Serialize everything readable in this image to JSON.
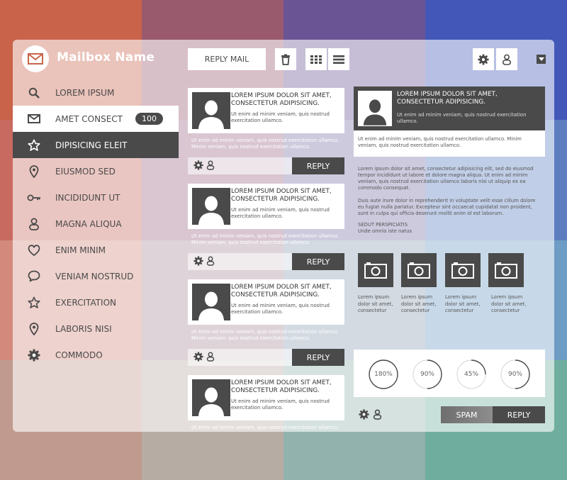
{
  "header": {
    "title": "Mailbox Name"
  },
  "sidebar": {
    "items": [
      {
        "label": "LOREM IPSUM",
        "icon": "search-icon"
      },
      {
        "label": "AMET CONSECT",
        "icon": "mail-icon",
        "badge": "100"
      },
      {
        "label": "DIPISICING ELEIT",
        "icon": "star-icon"
      },
      {
        "label": "EIUSMOD SED",
        "icon": "location-pin-icon"
      },
      {
        "label": "INCIDIDUNT UT",
        "icon": "key-icon"
      },
      {
        "label": "MAGNA ALIQUA",
        "icon": "user-icon"
      },
      {
        "label": "ENIM MINIM",
        "icon": "heart-icon"
      },
      {
        "label": "VENIAM NOSTRUD",
        "icon": "chat-bubble-icon"
      },
      {
        "label": "EXERCITATION",
        "icon": "star-icon"
      },
      {
        "label": "LABORIS NISI",
        "icon": "location-pin-icon"
      },
      {
        "label": "COMMODO",
        "icon": "gear-icon"
      }
    ]
  },
  "toolbar": {
    "reply_mail_label": "REPLY MAIL"
  },
  "messages": [
    {
      "title": "LOREM IPSUM DOLOR SIT AMET, CONSECTETUR ADIPISICING.",
      "snippet": "Ut enim ad minim veniam, quis nostrud exercitation ullamco.",
      "sub": "Ut enim ad minim veniam, quis nostrud exercitation ullamco. Minim veniam, quis nostrud exercitation ullamco.",
      "reply_label": "REPLY"
    },
    {
      "title": "LOREM IPSUM DOLOR SIT AMET, CONSECTETUR ADIPISICING.",
      "snippet": "Ut enim ad minim veniam, quis nostrud exercitation ullamco.",
      "sub": "Ut enim ad minim veniam, quis nostrud exercitation ullamco. Minim veniam, quis nostrud exercitation ullamco.",
      "reply_label": "REPLY"
    },
    {
      "title": "LOREM IPSUM DOLOR SIT AMET, CONSECTETUR ADIPISICING.",
      "snippet": "Ut enim ad minim veniam, quis nostrud exercitation ullamco.",
      "sub": "Ut enim ad minim veniam, quis nostrud exercitation ullamco. Minim veniam, quis nostrud exercitation ullamco.",
      "reply_label": "REPLY"
    },
    {
      "title": "LOREM IPSUM DOLOR SIT AMET, CONSECTETUR ADIPISICING.",
      "snippet": "Ut enim ad minim veniam, quis nostrud exercitation ullamco.",
      "sub": "Ut enim ad minim veniam, quis nostrud exercitation ullamco."
    }
  ],
  "detail": {
    "title": "LOREM IPSUM DOLOR SIT AMET, CONSECTETUR ADIPISICING.",
    "snippet": "Ut enim ad minim veniam, quis nostrud exercitation ullamco.",
    "summary": "Ut enim ad minim veniam, quis nostrud exercitation ullamco. Minim veniam, quis nostrud exercitation ullamco.",
    "body1": "Lorem ipsum dolor sit amet, consectetur adipisicing elit, sed do eiusmod tempor incididunt ut labore et dolore magna aliqua. Ut enim ad minim veniam, quis nostrud exercitation ullamco laboris nisi ut aliquip ex ea commodo consequat.",
    "body2": "Duis aute irure dolor in reprehenderit in voluptate velit esse cillum dolore eu fugiat nulla pariatur. Excepteur sint occaecat cupidatat non proident, sunt in culpa qui officia deserunt mollit anim id est laborum.",
    "body3": "SEDUT PERSPICIATIS",
    "body4": "Unde omnis iste natus",
    "photos": [
      {
        "caption": "Lorem ipsum dolor sit amet, consectetur"
      },
      {
        "caption": "Lorem ipsum dolor sit amet, consectetur"
      },
      {
        "caption": "Lorem ipsum dolor sit amet, consectetur"
      },
      {
        "caption": "Lorem ipsum dolor sit amet, consectetur"
      }
    ],
    "gauges": [
      {
        "label": "180%",
        "value": 180
      },
      {
        "label": "90%",
        "value": 90
      },
      {
        "label": "45%",
        "value": 45
      },
      {
        "label": "90%",
        "value": 90
      }
    ],
    "spam_label": "SPAM",
    "reply_label": "REPLY"
  },
  "colors": {
    "dark": "#4a4a4a",
    "background_tiles": [
      "#c9634a",
      "#9a5a6e",
      "#6a5494",
      "#4257b8",
      "#c86a60",
      "#9b6a86",
      "#7f74a8",
      "#5c7ec0",
      "#d38a7c",
      "#a98d98",
      "#8c9fb4",
      "#6d9cc4",
      "#c09a8e",
      "#b7aca3",
      "#92b2ad",
      "#6fae9e"
    ]
  }
}
